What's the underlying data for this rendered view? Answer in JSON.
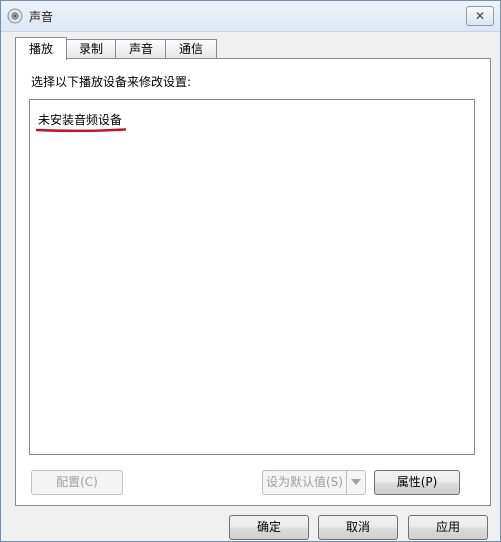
{
  "window": {
    "title": "声音"
  },
  "tabs": [
    {
      "label": "播放",
      "active": true
    },
    {
      "label": "录制",
      "active": false
    },
    {
      "label": "声音",
      "active": false
    },
    {
      "label": "通信",
      "active": false
    }
  ],
  "playback": {
    "instruction": "选择以下播放设备来修改设置:",
    "empty_message": "未安装音频设备",
    "underline_color": "#c8102e"
  },
  "buttons": {
    "configure": "配置(C)",
    "set_default": "设为默认值(S)",
    "properties": "属性(P)",
    "ok": "确定",
    "cancel": "取消",
    "apply": "应用"
  }
}
